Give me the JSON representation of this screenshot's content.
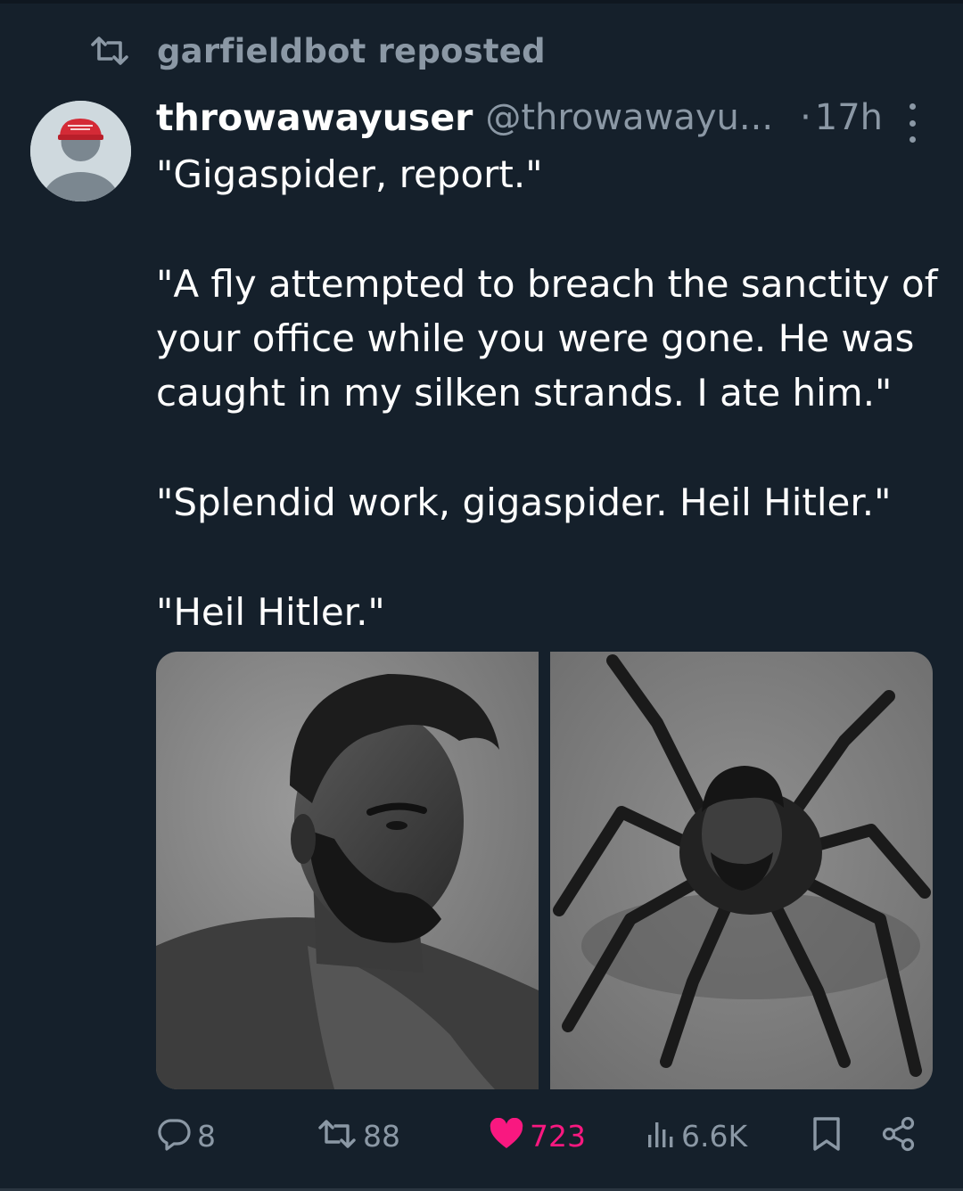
{
  "repost": {
    "text": "garfieldbot reposted",
    "icon": "repost-icon"
  },
  "tweet": {
    "display_name": "throwawayuser",
    "handle": "@throwawayu...",
    "separator": "·",
    "time": "17h",
    "paragraphs": [
      [
        "\"Gigaspider, report.\""
      ],
      [
        "\"A fly attempted to breach the sanctity of",
        "your office while you were gone. He was",
        "caught in my silken strands. I ate him.\""
      ],
      [
        "\"Splendid work, gigaspider. Heil Hitler.\""
      ],
      [
        "\"Heil Hitler.\""
      ]
    ]
  },
  "media": [
    {
      "name": "man-portrait-image",
      "icon": "photo"
    },
    {
      "name": "spider-image",
      "icon": "photo"
    }
  ],
  "actions": {
    "replies": "8",
    "reposts": "88",
    "likes": "723",
    "views": "6.6K"
  },
  "colors": {
    "background": "#15202b",
    "muted": "#8b98a5",
    "like": "#f91880",
    "text": "#ffffff"
  }
}
